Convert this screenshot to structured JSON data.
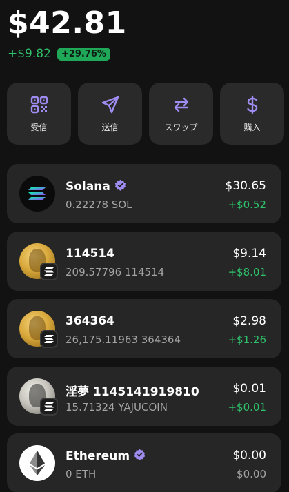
{
  "portfolio": {
    "balance": "$42.81",
    "change_abs": "+$9.82",
    "change_pct": "+29.76%"
  },
  "actions": [
    {
      "label": "受信",
      "icon": "qr-code-icon"
    },
    {
      "label": "送信",
      "icon": "send-icon"
    },
    {
      "label": "スワップ",
      "icon": "swap-icon"
    },
    {
      "label": "購入",
      "icon": "dollar-icon"
    }
  ],
  "tokens": [
    {
      "name": "Solana",
      "verified": true,
      "amount": "0.22278 SOL",
      "usd": "$30.65",
      "change": "+$0.52"
    },
    {
      "name": "114514",
      "verified": false,
      "amount": "209.57796 114514",
      "usd": "$9.14",
      "change": "+$8.01"
    },
    {
      "name": "364364",
      "verified": false,
      "amount": "26,175.11963 364364",
      "usd": "$2.98",
      "change": "+$1.26"
    },
    {
      "name": "淫夢 1145141919810",
      "verified": false,
      "amount": "15.71324 YAJUCOIN",
      "usd": "$0.01",
      "change": "+$0.01"
    },
    {
      "name": "Ethereum",
      "verified": true,
      "amount": "0 ETH",
      "usd": "$0.00",
      "change": "$0.00"
    }
  ],
  "colors": {
    "accent": "#9e8cf0",
    "positive": "#2ec26b",
    "card": "#262626",
    "background": "#121212"
  }
}
